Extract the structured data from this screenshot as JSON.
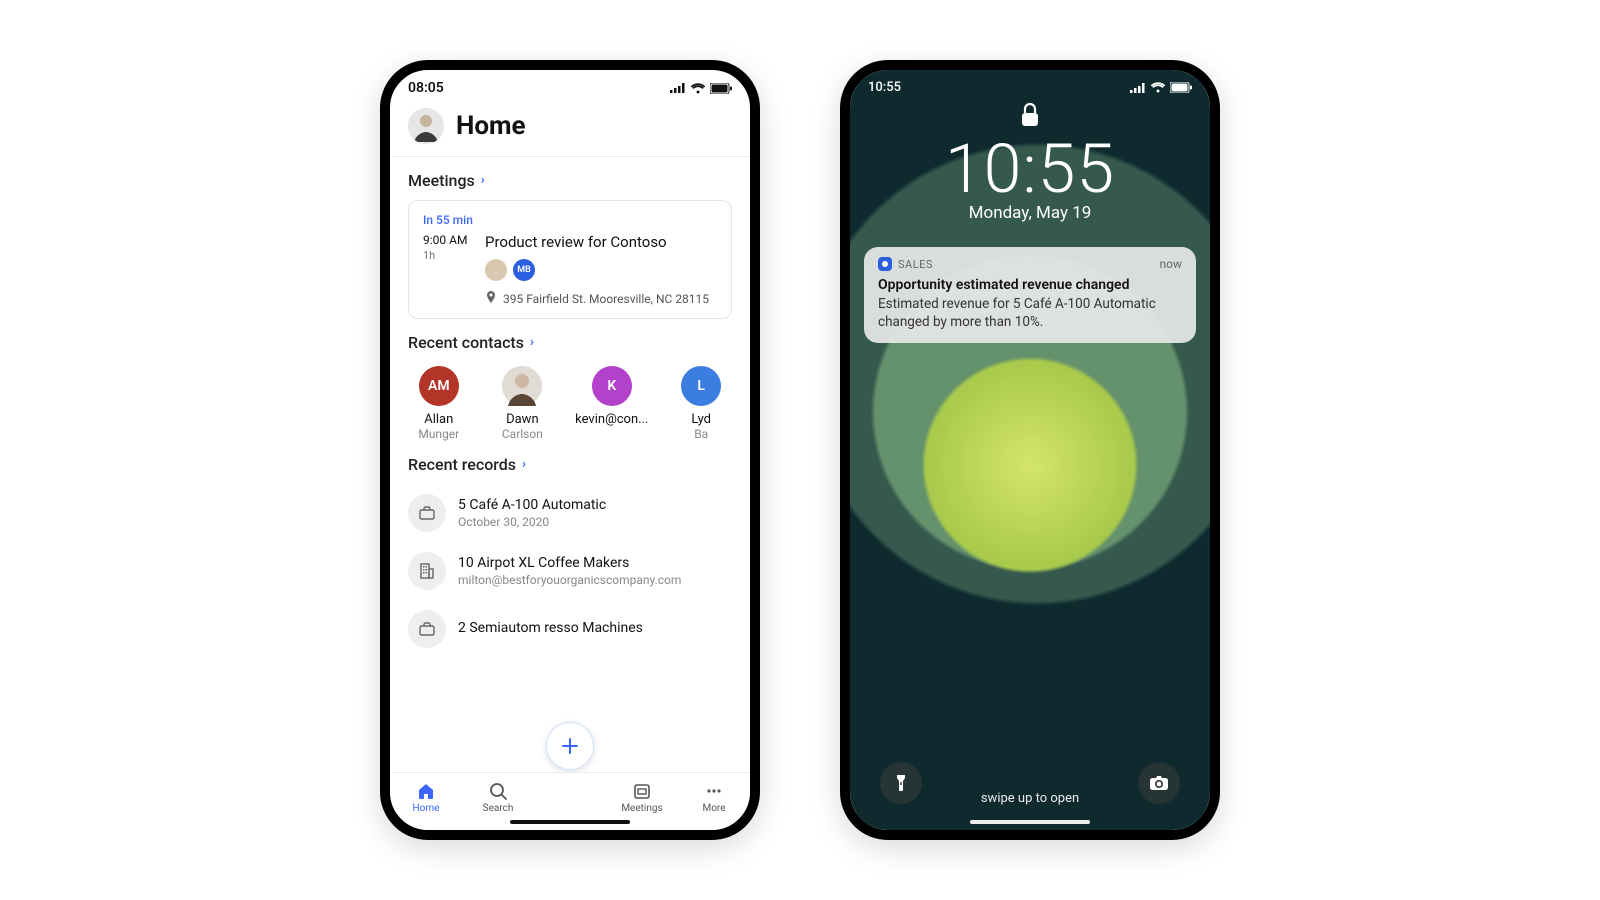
{
  "phone1": {
    "status_time": "08:05",
    "header_title": "Home",
    "meetings": {
      "heading": "Meetings",
      "relative": "In 55 min",
      "time": "9:00 AM",
      "duration": "1h",
      "title": "Product review for Contoso",
      "attendee_badge": "MB",
      "address": "395 Fairfield St. Mooresville, NC 28115"
    },
    "contacts": {
      "heading": "Recent contacts",
      "items": [
        {
          "initials": "AM",
          "name": "Allan",
          "sub": "Munger"
        },
        {
          "initials": "",
          "name": "Dawn",
          "sub": "Carlson"
        },
        {
          "initials": "K",
          "name": "kevin@con...",
          "sub": ""
        },
        {
          "initials": "L",
          "name": "Lyd",
          "sub": "Ba"
        }
      ]
    },
    "records": {
      "heading": "Recent records",
      "items": [
        {
          "title": "5 Café A-100 Automatic",
          "sub": "October 30, 2020"
        },
        {
          "title": "10 Airpot XL Coffee Makers",
          "sub": "milton@bestforyouorganicscompany.com"
        },
        {
          "title": "2 Semiautom         resso Machines",
          "sub": ""
        }
      ]
    },
    "tabs": {
      "home": "Home",
      "search": "Search",
      "meetings": "Meetings",
      "more": "More"
    }
  },
  "phone2": {
    "status_time": "10:55",
    "clock": "10:55",
    "date": "Monday, May 19",
    "notification": {
      "app": "SALES",
      "when": "now",
      "title": "Opportunity estimated revenue changed",
      "body": "Estimated revenue for 5 Café A-100 Automatic changed by more than 10%."
    },
    "swipe": "swipe up to open"
  }
}
